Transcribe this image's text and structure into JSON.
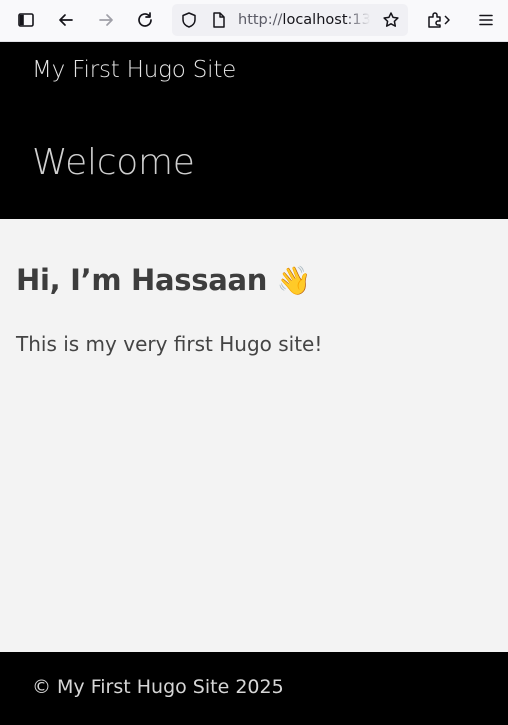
{
  "browser": {
    "url_scheme": "http://",
    "url_host": "localhost",
    "url_rest": ":13"
  },
  "header": {
    "site_title": "My First Hugo Site",
    "page_heading": "Welcome"
  },
  "main": {
    "heading": "Hi, I’m Hassaan",
    "heading_emoji": "👋",
    "paragraph": "This is my very first Hugo site!"
  },
  "footer": {
    "copyright": "© My First Hugo Site 2025"
  }
}
